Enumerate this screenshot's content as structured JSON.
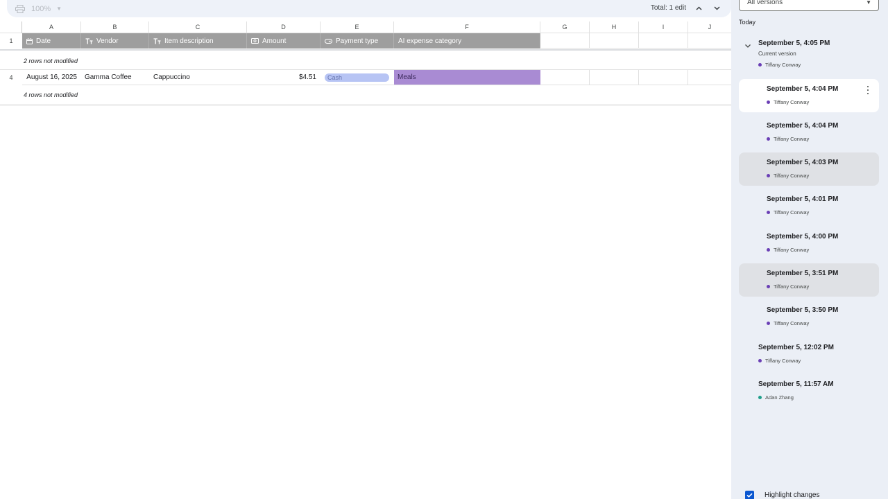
{
  "toolbar": {
    "zoom": "100%",
    "total_edits": "Total: 1 edit"
  },
  "grid": {
    "columns": [
      "A",
      "B",
      "C",
      "D",
      "E",
      "F",
      "G",
      "H",
      "I",
      "J"
    ],
    "header_row_number": "1",
    "headers": [
      "Date",
      "Vendor",
      "Item description",
      "Amount",
      "Payment type",
      "AI expense category"
    ],
    "collapsed_top": "2 rows not modified",
    "data_row": {
      "row_number": "4",
      "date": "August 16, 2025",
      "vendor": "Gamma Coffee",
      "item": "Cappuccino",
      "amount": "$4.51",
      "payment": "Cash",
      "category": "Meals"
    },
    "collapsed_bottom": "4 rows not modified"
  },
  "panel": {
    "filter_value": "All versions",
    "group_label": "Today",
    "current_version_label": "Current version",
    "versions": [
      {
        "time": "September 5, 4:05 PM",
        "user": "Tiffany Conway",
        "user_color": "#6a3fb5"
      },
      {
        "time": "September 5, 4:04 PM",
        "user": "Tiffany Conway",
        "user_color": "#6a3fb5"
      },
      {
        "time": "September 5, 4:04 PM",
        "user": "Tiffany Conway",
        "user_color": "#6a3fb5"
      },
      {
        "time": "September 5, 4:03 PM",
        "user": "Tiffany Conway",
        "user_color": "#6a3fb5"
      },
      {
        "time": "September 5, 4:01 PM",
        "user": "Tiffany Conway",
        "user_color": "#6a3fb5"
      },
      {
        "time": "September 5, 4:00 PM",
        "user": "Tiffany Conway",
        "user_color": "#6a3fb5"
      },
      {
        "time": "September 5, 3:51 PM",
        "user": "Tiffany Conway",
        "user_color": "#6a3fb5"
      },
      {
        "time": "September 5, 3:50 PM",
        "user": "Tiffany Conway",
        "user_color": "#6a3fb5"
      },
      {
        "time": "September 5, 12:02 PM",
        "user": "Tiffany Conway",
        "user_color": "#6a3fb5"
      },
      {
        "time": "September 5, 11:57 AM",
        "user": "Adan Zhang",
        "user_color": "#1e9e8a"
      }
    ],
    "highlight_label": "Highlight changes"
  },
  "colors": {
    "header_fill": "#9e9e9e",
    "cash_chip": "#b7c4f4",
    "meals_fill": "#a98bd3",
    "panel_bg": "#ebeff6",
    "checkbox": "#0b57d0"
  }
}
